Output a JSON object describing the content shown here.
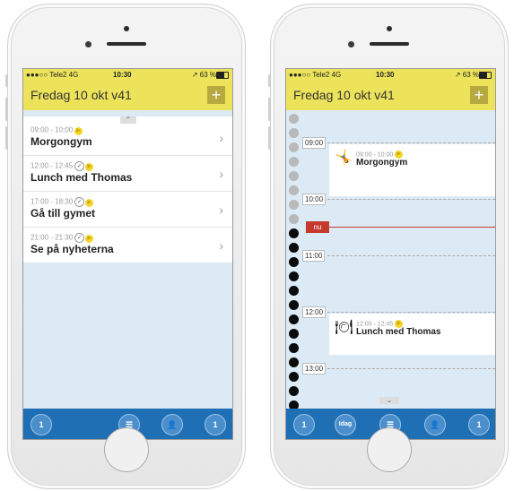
{
  "status": {
    "carrier": "●●●○○ Tele2  4G",
    "time": "10:30",
    "battery": "↗ 63 %"
  },
  "left": {
    "title": "Fredag 10 okt v41",
    "plus": "+",
    "collapse": "⌃",
    "items": [
      {
        "time": "09:00 - 10:00",
        "name": "Morgongym"
      },
      {
        "time": "12:00 - 12:45",
        "name": "Lunch med Thomas"
      },
      {
        "time": "17:00 - 18:30",
        "name": "Gå till gymet"
      },
      {
        "time": "21:00 - 21:30",
        "name": "Se på nyheterna"
      }
    ],
    "toolbar": [
      "1",
      "☰",
      "👤",
      "1"
    ]
  },
  "right": {
    "title": "Fredag 10 okt v41",
    "plus": "+",
    "times": [
      "09:00",
      "10:00",
      "11:00",
      "12:00",
      "13:00"
    ],
    "now_label": "nu",
    "events": [
      {
        "time": "09:00 - 10:00",
        "name": "Morgongym",
        "icon": "person-exercise-icon"
      },
      {
        "time": "12:00 - 12:45",
        "name": "Lunch med Thomas",
        "icon": "lunch-plate-icon"
      }
    ],
    "expand": "⌄",
    "toolbar": [
      "1",
      "Idag",
      "☰",
      "👤",
      "1"
    ]
  }
}
